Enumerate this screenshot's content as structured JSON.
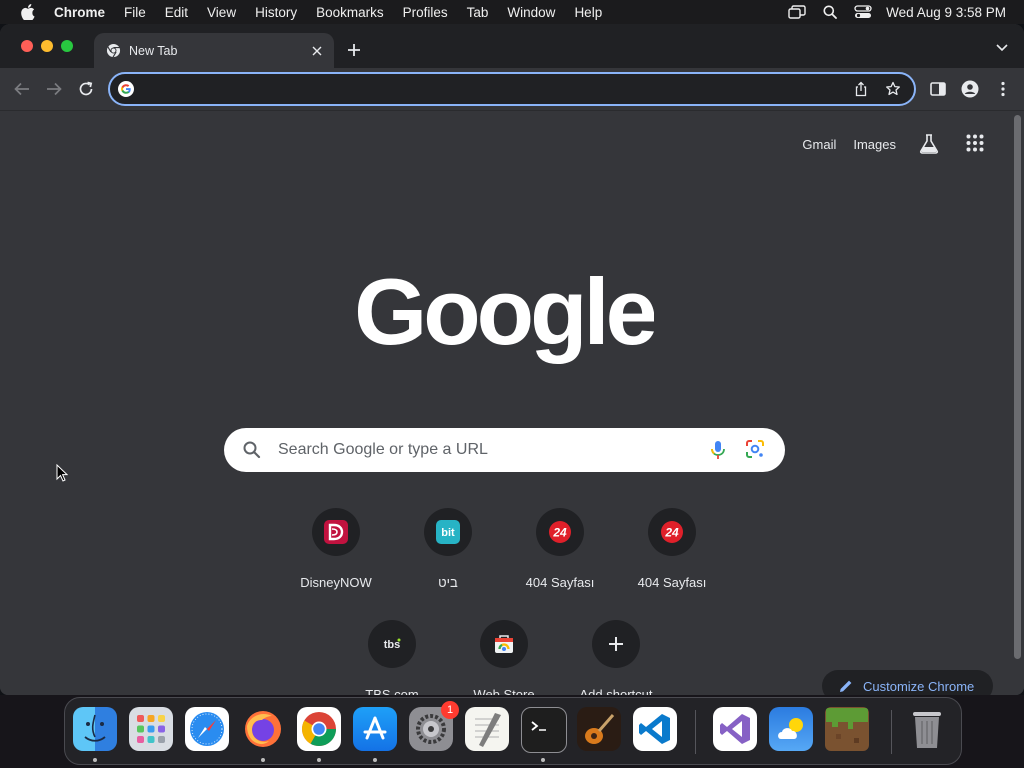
{
  "menubar": {
    "app_name": "Chrome",
    "items": [
      "File",
      "Edit",
      "View",
      "History",
      "Bookmarks",
      "Profiles",
      "Tab",
      "Window",
      "Help"
    ],
    "clock": "Wed Aug 9  3:58 PM"
  },
  "tab": {
    "title": "New Tab"
  },
  "omnibox": {
    "value": "",
    "accent_color": "#8ab4f8"
  },
  "top_links": {
    "gmail": "Gmail",
    "images": "Images"
  },
  "logo_text": "Google",
  "search": {
    "placeholder": "Search Google or type a URL"
  },
  "shortcuts": [
    {
      "label": "DisneyNOW",
      "icon": "disneynow-icon"
    },
    {
      "label": "ביט",
      "icon": "bit-icon"
    },
    {
      "label": "404 Sayfası",
      "icon": "24-red-icon"
    },
    {
      "label": "404 Sayfası",
      "icon": "24-red-icon"
    },
    {
      "label": "TBS.com",
      "icon": "tbs-icon"
    },
    {
      "label": "Web Store",
      "icon": "web-store-icon"
    },
    {
      "label": "Add shortcut",
      "icon": "plus-icon"
    }
  ],
  "customize": {
    "label": "Customize Chrome"
  },
  "dock": {
    "apps": [
      "Finder",
      "Launchpad",
      "Safari",
      "Firefox",
      "Chrome",
      "App Store",
      "System Settings",
      "TextEdit",
      "Terminal",
      "GarageBand",
      "Visual Studio Code",
      "Visual Studio",
      "Weather",
      "Minecraft",
      "Trash"
    ],
    "settings_badge": "1"
  },
  "colors": {
    "background": "#35363a",
    "tabstrip": "#202124",
    "link_blue": "#8ab4f8"
  }
}
